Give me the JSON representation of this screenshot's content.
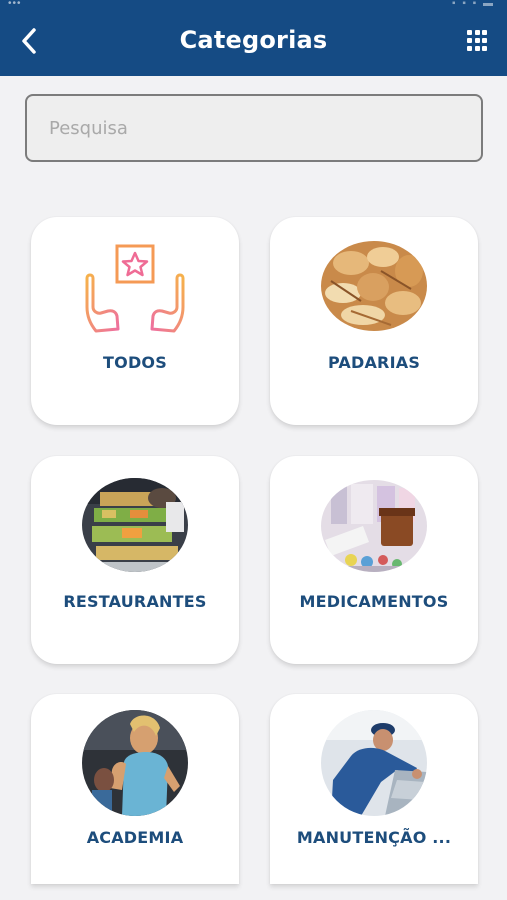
{
  "header": {
    "title": "Categorias",
    "back_icon": "chevron-left-icon",
    "menu_icon": "grid-icon"
  },
  "search": {
    "placeholder": "Pesquisa",
    "value": ""
  },
  "categories": [
    {
      "label": "TODOS",
      "icon": "hands-star-icon"
    },
    {
      "label": "PADARIAS",
      "icon": "bread-image"
    },
    {
      "label": "RESTAURANTES",
      "icon": "buffet-image"
    },
    {
      "label": "MEDICAMENTOS",
      "icon": "medicine-image"
    },
    {
      "label": "ACADEMIA",
      "icon": "gym-image"
    },
    {
      "label": "MANUTENÇÃO ...",
      "icon": "mechanic-image"
    }
  ],
  "colors": {
    "header_bg": "#154b84",
    "label": "#1d4d7c",
    "page_bg": "#f2f2f4"
  }
}
